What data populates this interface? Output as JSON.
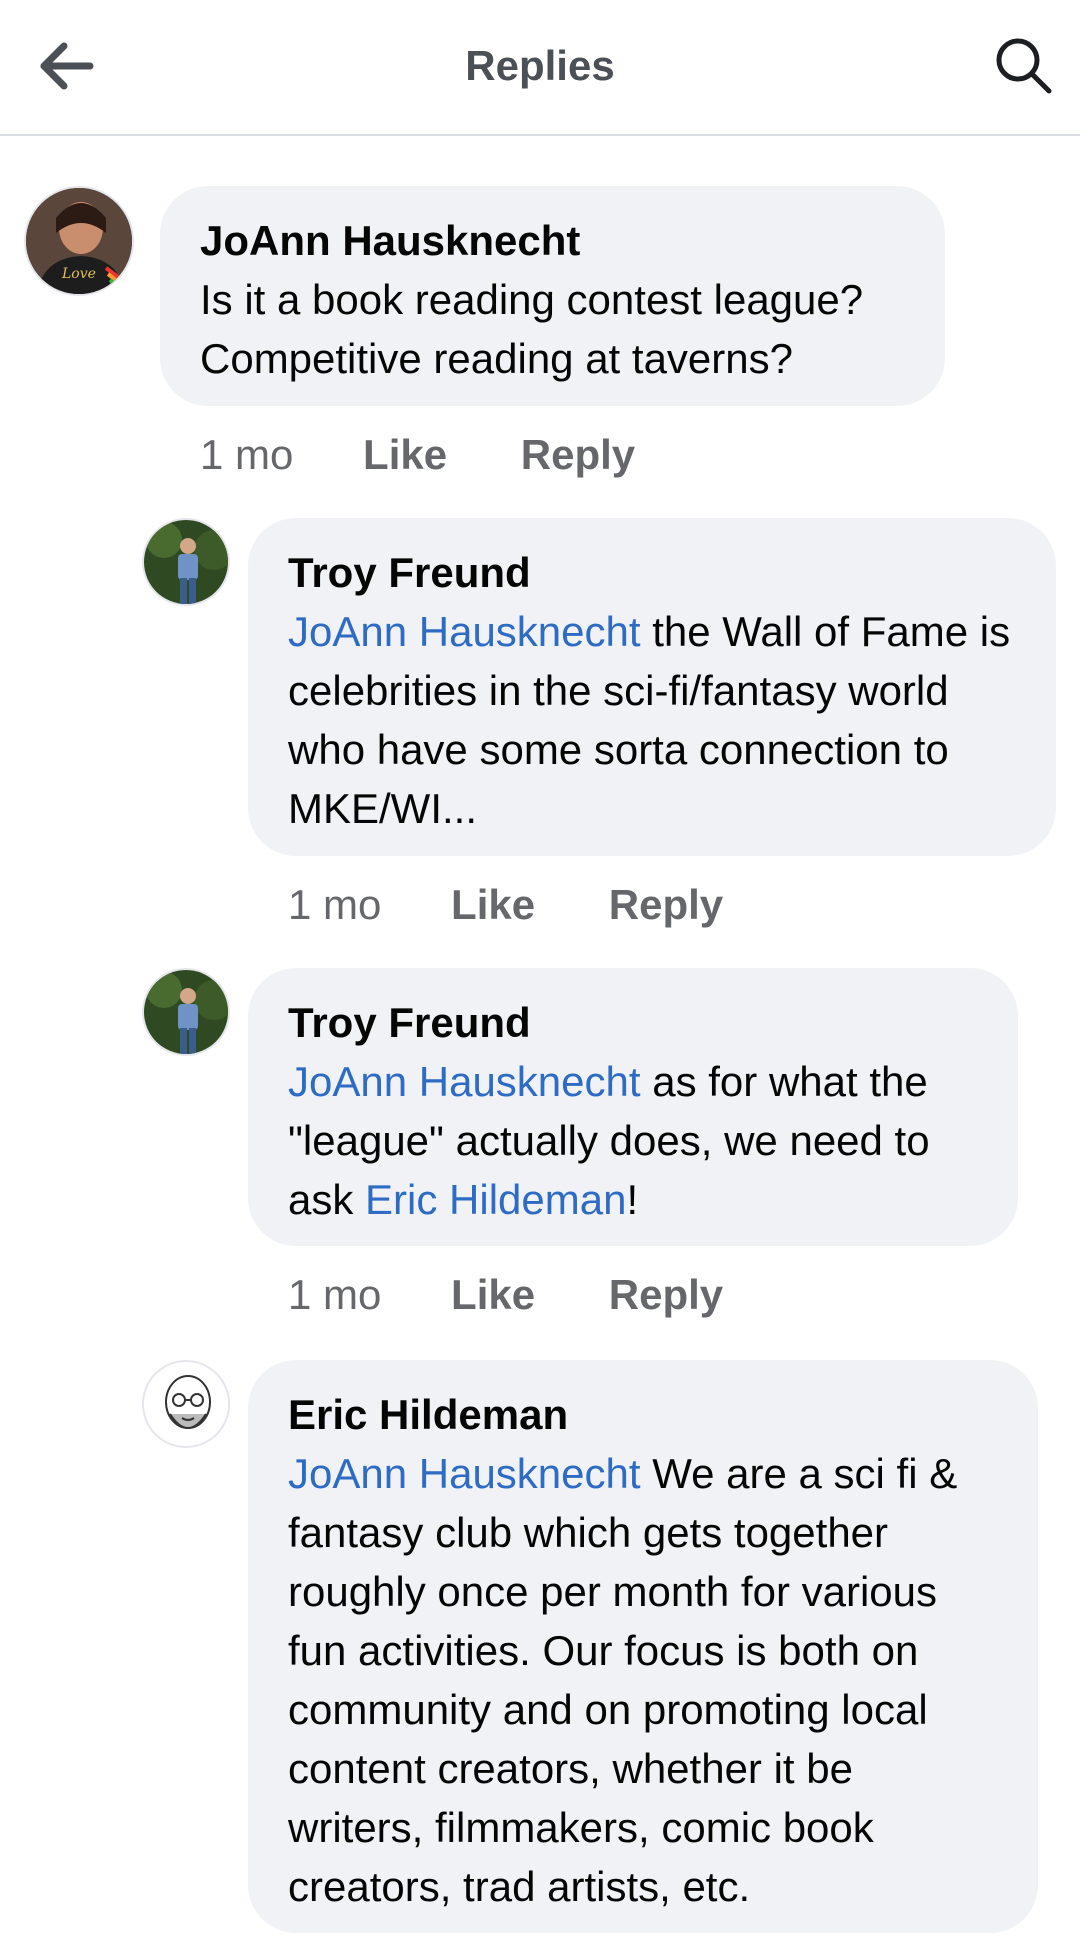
{
  "header": {
    "title": "Replies",
    "back_icon": "back-arrow-icon",
    "search_icon": "search-icon"
  },
  "comments": [
    {
      "author": "JoAnn Hausknecht",
      "mention": "",
      "text": "Is it a book reading contest league? Competitive reading at taverns?",
      "time": "1 mo",
      "like": "Like",
      "reply": "Reply"
    },
    {
      "author": "Troy Freund",
      "mention": "JoAnn Hausknecht",
      "text": " the Wall of Fame is celebrities in the sci-fi/fantasy world who have some sorta connection to MKE/WI...",
      "time": "1 mo",
      "like": "Like",
      "reply": "Reply"
    },
    {
      "author": "Troy Freund",
      "mention": "JoAnn Hausknecht",
      "text": " as for what the \"league\" actually does, we need to ask ",
      "mention2": "Eric Hildeman",
      "text_end": "!",
      "time": "1 mo",
      "like": "Like",
      "reply": "Reply"
    },
    {
      "author": "Eric Hildeman",
      "mention": "JoAnn Hausknecht",
      "text": " We are a sci fi & fantasy club which gets together roughly once per month for various fun activities. Our focus is both on community and on promoting local content creators, whether it be writers, filmmakers, comic book creators, trad artists, etc."
    }
  ],
  "colors": {
    "bubble": "#f0f2f5",
    "mention": "#2d6bc4",
    "meta": "#65676b",
    "header_title": "#4b4f56"
  }
}
